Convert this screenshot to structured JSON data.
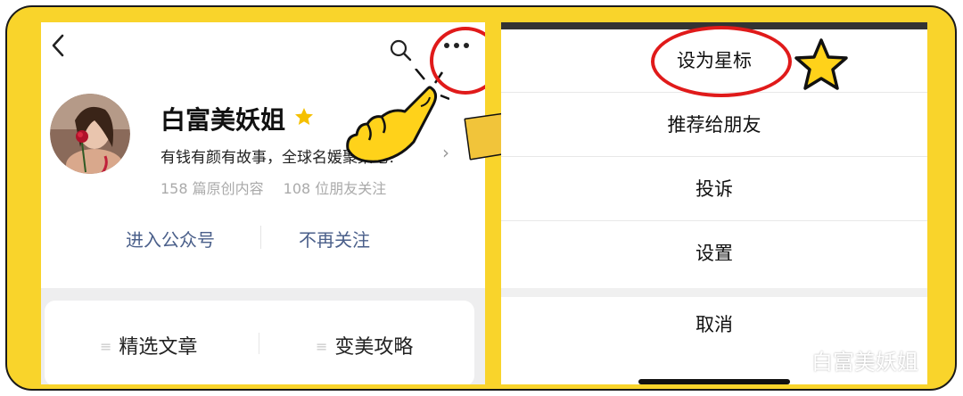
{
  "profile": {
    "name": "白富美妖姐",
    "description": "有钱有颜有故事，全球名媛聚集地！",
    "stats": {
      "articles": "158 篇原创内容",
      "friends": "108 位朋友关注"
    },
    "actions": {
      "enter": "进入公众号",
      "unfollow": "不再关注"
    },
    "menu": [
      "精选文章",
      "变美攻略"
    ]
  },
  "sheet": {
    "options": [
      "设为星标",
      "推荐给朋友",
      "投诉",
      "设置"
    ],
    "cancel": "取消"
  },
  "watermark": "白富美妖姐",
  "colors": {
    "frame": "#f9d42b",
    "link": "#4a5f8a",
    "highlight": "#e01a1a",
    "star": "#f5c000"
  },
  "icons": [
    "back-icon",
    "search-icon",
    "more-icon",
    "star-icon",
    "chevron-right-icon",
    "pointing-hand-icon",
    "arrow-icon",
    "wechat-icon"
  ]
}
